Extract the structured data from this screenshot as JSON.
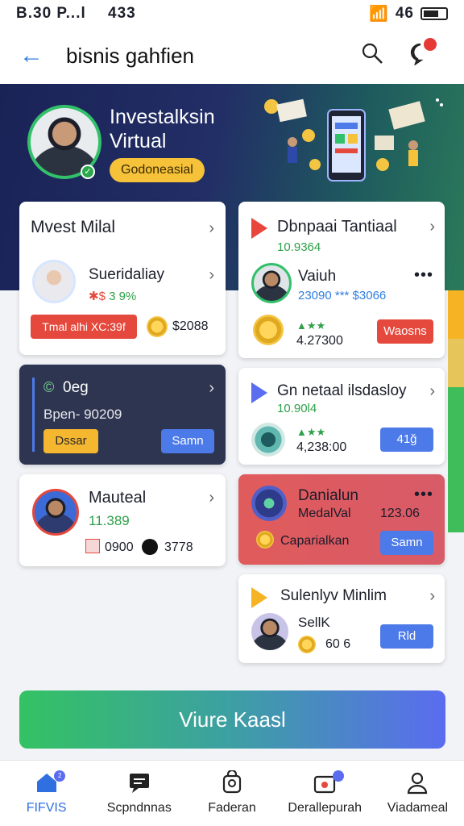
{
  "status": {
    "time": "B.30 P...l",
    "signal_text": "433",
    "battery_text": "46"
  },
  "header": {
    "title": "bisnis gahfien"
  },
  "hero": {
    "title": "Investalksin Virtual",
    "pill": "Godoneasial"
  },
  "cards": {
    "invest": {
      "title": "Mvest Milal",
      "name": "Sueridaliay",
      "change": "3 9%",
      "button": "Tmal alhi XC:39f",
      "amount": "$2088"
    },
    "dark": {
      "title": "0eg",
      "line": "Bpen- 90209",
      "button_left": "Dssar",
      "button_right": "Samn"
    },
    "manual": {
      "title": "Mauteal",
      "value": "11.389",
      "stat1": "0900",
      "stat2": "3778"
    },
    "right1": {
      "title": "Dbnpaai Tantiaal",
      "value": "10.9364",
      "name": "Vaiuh",
      "stats": "23090 *** $3066",
      "amount": "4.27300",
      "button": "Waosns"
    },
    "right2": {
      "title": "Gn netaal ilsdasloy",
      "value": "10.90l4",
      "amount": "4,238:00",
      "button": "41ğ"
    },
    "right3": {
      "title": "Danialun",
      "subtitle": "MedalVal",
      "value": "123.06",
      "label": "Caparialkan",
      "button": "Samn"
    },
    "right4": {
      "title": "Sulenlyv Minlim",
      "name": "SellK",
      "amount": "60 6",
      "button": "Rld"
    }
  },
  "cta": {
    "label": "Viure Kaasl"
  },
  "nav": [
    {
      "label": "FIFVIS",
      "icon": "home-icon"
    },
    {
      "label": "Scpndnnas",
      "icon": "chat-icon"
    },
    {
      "label": "Faderan",
      "icon": "bag-icon"
    },
    {
      "label": "Derallepurah",
      "icon": "wallet-icon"
    },
    {
      "label": "Viadameal",
      "icon": "person-icon"
    }
  ],
  "colors": {
    "accent": "#2f7de1",
    "green": "#33c06a",
    "red": "#e5483c",
    "blue": "#4c7ae8",
    "yellow": "#f6c23a",
    "hero_bg": "#1a2356"
  }
}
